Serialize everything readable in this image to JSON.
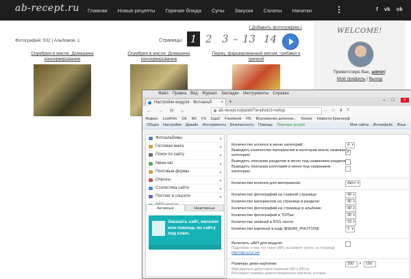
{
  "site": {
    "logo": "ab-recept.ru",
    "nav": [
      "Главная",
      "Новые рецепты",
      "Горячие блюда",
      "Супы",
      "Закуски",
      "Салаты",
      "Напитки"
    ],
    "social": [
      "f",
      "vk",
      "ok"
    ]
  },
  "gallery": {
    "counts": "Фотографий: 532 | Альбомов: 1",
    "add_photo": "[ Добавить фотографию ]",
    "pages_label": "Страницы:",
    "pages": [
      "1",
      "2",
      "3",
      "13",
      "14"
    ],
    "photos": [
      {
        "title": "Скумбрия в масле. Домашнее консервирование"
      },
      {
        "title": "Скумбрия в масле. Домашнее консервирование"
      },
      {
        "title": "Перец, фаршированный мясом, грибами и гречкой"
      }
    ]
  },
  "widget": {
    "welcome": "WELCOME!",
    "greeting_prefix": "Приветствую Вас,",
    "username": "admin",
    "profile_link": "Мой профиль",
    "logout_link": "Выход"
  },
  "browser": {
    "menu": [
      "Файл",
      "Правка",
      "Вид",
      "Журнал",
      "Закладки",
      "Инструменты",
      "Справка"
    ],
    "tab_title": "Настройки модуля · Фотоальб",
    "new_tab": "+",
    "url": "ab-recept.ru/panel/?a=photo1=setup",
    "url_icons": [
      "…",
      "☆",
      "⬇",
      "≡"
    ],
    "bookmarks": [
      "Яндекс",
      "LostFilm",
      "ОК",
      "BK",
      "FS",
      "Еда2",
      "Facebook",
      "РБ",
      "Возложение дополни...",
      "Kontur",
      "Новости Красноуф"
    ],
    "ucoz_bar": [
      "Общее",
      "Настройки",
      "Дизайн",
      "Инструменты",
      "Безопасность",
      "Помощь",
      "Платные услуги",
      "Мои сайты",
      "Интерфейс",
      "Язык"
    ]
  },
  "panel_sidebar": {
    "items": [
      {
        "label": "Фотоальбомы",
        "color": "#4a7fc0"
      },
      {
        "label": "Гостевая книга",
        "color": "#c9a23a"
      },
      {
        "label": "Поиск по сайту",
        "color": "#6d6d6d"
      },
      {
        "label": "Мини-чат",
        "color": "#5aa85a"
      },
      {
        "label": "Почтовые формы",
        "color": "#d0a040"
      },
      {
        "label": "Опросы",
        "color": "#c05050"
      },
      {
        "label": "Статистика сайта",
        "color": "#4a8ad0"
      },
      {
        "label": "Постинг в соцсети",
        "color": "#7a5ac0"
      },
      {
        "label": "SEO-модуль",
        "color": "#3aa0a0"
      }
    ],
    "tabs": [
      "Активные",
      "Неактивные"
    ],
    "promo": "Заказать сайт, магазин или помощь по сайту под ключ."
  },
  "settings": {
    "menu_columns_label": "Количество колонок в меню категорий:",
    "menu_columns_value": "4",
    "show_materials_count": "Выводить количество материалов в категории возле названия категории:",
    "show_section_desc": "Выводить описание разделов в меню под названием раздела:",
    "show_category_desc": "Выводить описание категорий в меню под названием категории:",
    "material_columns_label": "Количество колонок для материалов:",
    "material_columns_value": "Авто",
    "main_page_photos_label": "Количество фотографий на главной странице:",
    "main_page_photos_value": "40",
    "section_materials_label": "Количество материалов на странице в разделе:",
    "section_materials_value": "40",
    "album_photos_label": "Количество фотографий на странице в альбоме:",
    "album_photos_value": "40",
    "top_photos_label": "Количество фотографий в ТОПах:",
    "top_photos_value": "30",
    "rss_label": "Количество записей в RSS ленте:",
    "rss_value": "10",
    "code_label": "Количество картинок в коде $NEAR_PHOTOS$:",
    "code_value": "3",
    "uapi_label": "Включить uAPI для модуля:",
    "uapi_note": "Подробнее о том, что такое uAPI, вы можете узнать на странице",
    "uapi_link": "http://api.ucoz.net",
    "demo_size_label": "Размеры демо-картинки:",
    "demo_w": "200",
    "demo_x": "×",
    "demo_h": "150",
    "demo_note1": "Максимально допустимое значение 300 x 300 px",
    "demo_note2": "Регулирует размеры демонстрационных картинок, которые"
  }
}
